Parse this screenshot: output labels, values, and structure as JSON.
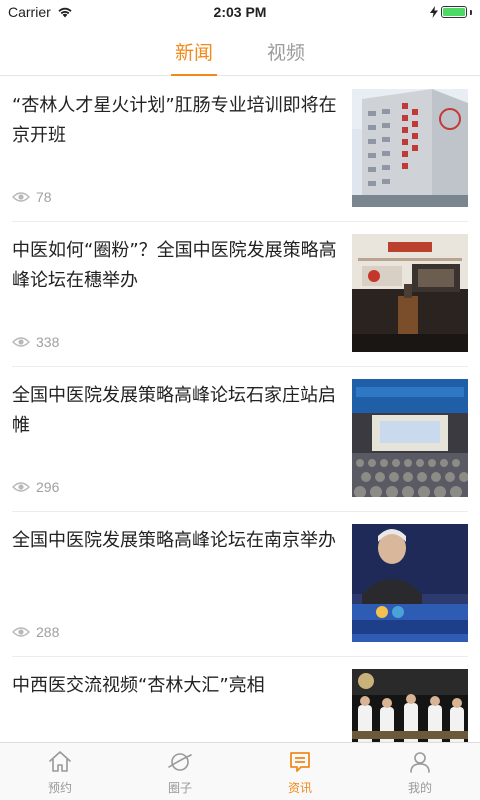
{
  "status_bar": {
    "carrier": "Carrier",
    "time": "2:03 PM",
    "battery_level": 1.0
  },
  "top_tabs": [
    {
      "label": "新闻",
      "active": true
    },
    {
      "label": "视频",
      "active": false
    }
  ],
  "news": [
    {
      "title": "“杏林人才星火计划”肛肠专业培训即将在京开班",
      "views": "78",
      "thumb": "hospital-building"
    },
    {
      "title": "中医如何“圈粉”？全国中医院发展策略高峰论坛在穗举办",
      "views": "338",
      "thumb": "conference-podium"
    },
    {
      "title": "全国中医院发展策略高峰论坛石家庄站启帷",
      "views": "296",
      "thumb": "conference-hall"
    },
    {
      "title": "全国中医院发展策略高峰论坛在南京举办",
      "views": "288",
      "thumb": "speaker-portrait"
    },
    {
      "title": "中西医交流视频“杏林大汇”亮相",
      "views": "",
      "thumb": "video-stage"
    }
  ],
  "tab_bar": [
    {
      "label": "预约",
      "icon": "home-icon",
      "active": false
    },
    {
      "label": "圈子",
      "icon": "planet-icon",
      "active": false
    },
    {
      "label": "资讯",
      "icon": "news-icon",
      "active": true
    },
    {
      "label": "我的",
      "icon": "user-icon",
      "active": false
    }
  ],
  "colors": {
    "accent": "#f08a1c",
    "inactive": "#9b9b9b"
  }
}
